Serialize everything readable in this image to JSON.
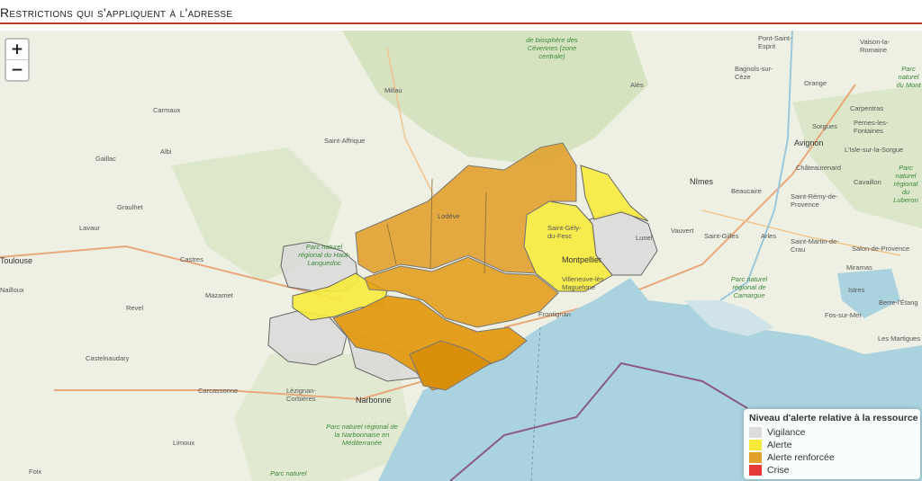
{
  "header": {
    "title": "Restrictions qui s'appliquent à l'adresse"
  },
  "zoom": {
    "in_label": "+",
    "out_label": "−"
  },
  "legend": {
    "title": "Niveau d'alerte relative à la ressource",
    "items": [
      {
        "label": "Vigilance",
        "color": "#dcdcdc"
      },
      {
        "label": "Alerte",
        "color": "#f5e93a"
      },
      {
        "label": "Alerte renforcée",
        "color": "#e3a02c"
      },
      {
        "label": "Crise",
        "color": "#e53935"
      }
    ]
  },
  "zone_colors": {
    "vigilance": "#d9d9d9",
    "alerte": "#f7ea3c",
    "renforcee": "#e1a12e",
    "renforcee_dark": "#e29a12",
    "sea": "#aad3df"
  },
  "places": {
    "millau": "Millau",
    "carmaux": "Carmaux",
    "albi": "Albi",
    "gaillac": "Gaillac",
    "saint_affrique": "Saint-Affrique",
    "graulhet": "Graulhet",
    "lavaur": "Lavaur",
    "castres": "Castres",
    "mazamet": "Mazamet",
    "revel": "Revel",
    "castelnaudary": "Castelnaudary",
    "carcassonne": "Carcassonne",
    "limoux": "Limoux",
    "foix": "Foix",
    "lezignan": "Lézignan-Corbières",
    "narbonne": "Narbonne",
    "lodeve": "Lodève",
    "alès": "Alès",
    "nimes": "Nîmes",
    "beaucaire": "Beaucaire",
    "vauvert": "Vauvert",
    "saint_gilles": "Saint-Gilles",
    "arles": "Arles",
    "avignon": "Avignon",
    "orange": "Orange",
    "carpentras": "Carpentras",
    "sorgues": "Sorgues",
    "cavaillon": "Cavaillon",
    "chateaurenard": "Châteaurenard",
    "saint_remy": "Saint-Rémy-de-Provence",
    "saint_martin_crau": "Saint-Martin-de-Crau",
    "salon": "Salon-de-Provence",
    "miramas": "Miramas",
    "istres": "Istres",
    "fos": "Fos-sur-Mer",
    "berre": "Berre-l'Étang",
    "martigues": "Les Martigues",
    "bagnols": "Bagnols-sur-Cèze",
    "vaison": "Vaison-la-Romaine",
    "pont_saint_esprit": "Pont-Saint-Esprit",
    "pernes": "Pernes-les-Fontaines",
    "isle_sorgue": "L'Isle-sur-la-Sorgue",
    "toulouse": "Toulouse",
    "nailloux": "Nailloux",
    "montpellier": "Montpellier",
    "frontignan": "Frontignan",
    "lunel": "Lunel",
    "saint_gely": "Saint-Gély-du-Fesc",
    "villeneuve": "Villeneuve-lès-Maguelone",
    "park_cevennes": "de biosphère des Cévennes (zone centrale)",
    "park_haut_languedoc": "Parc naturel régional du Haut-Languedoc",
    "park_camargue": "Parc naturel régional de Camargue",
    "park_narbonnaise": "Parc naturel régional de la Narbonnaise en Méditerranée",
    "park_luberon": "Parc naturel régional du Luberon",
    "park_monts": "Parc naturel du Mont",
    "park_bottom": "Parc naturel"
  }
}
